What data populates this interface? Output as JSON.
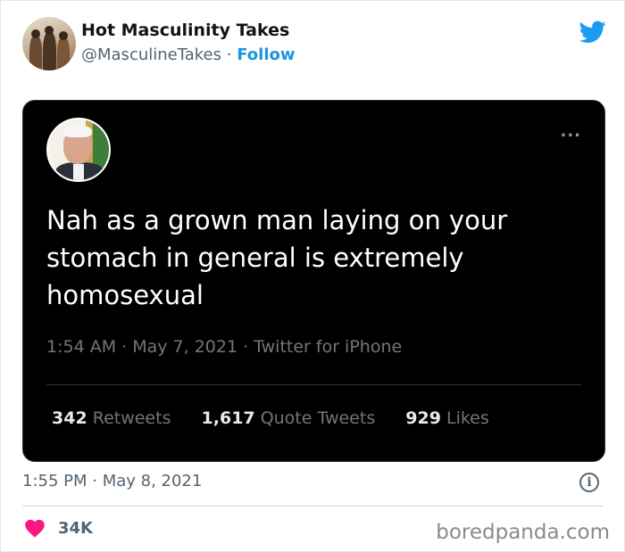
{
  "account": {
    "name": "Hot Masculinity Takes",
    "handle": "@MasculineTakes",
    "separator": "·",
    "follow_label": "Follow"
  },
  "icons": {
    "brand": "twitter-bird-icon",
    "more": "more-options-icon",
    "info": "info-icon",
    "like": "heart-icon"
  },
  "embedded_tweet": {
    "text": "Nah as a grown man laying on your stomach in general is extremely homosexual",
    "meta": "1:54 AM · May 7, 2021 · Twitter for iPhone",
    "more_label": "...",
    "stats": [
      {
        "count": "342",
        "label": "Retweets"
      },
      {
        "count": "1,617",
        "label": "Quote Tweets"
      },
      {
        "count": "929",
        "label": "Likes"
      }
    ]
  },
  "footer": {
    "timestamp": "1:55 PM · May 8, 2021",
    "info_label": "i",
    "likes": "34K",
    "watermark": "boredpanda.com"
  },
  "colors": {
    "accent": "#1d9bf0",
    "heart": "#f91880",
    "embedded_bg": "#000000"
  }
}
